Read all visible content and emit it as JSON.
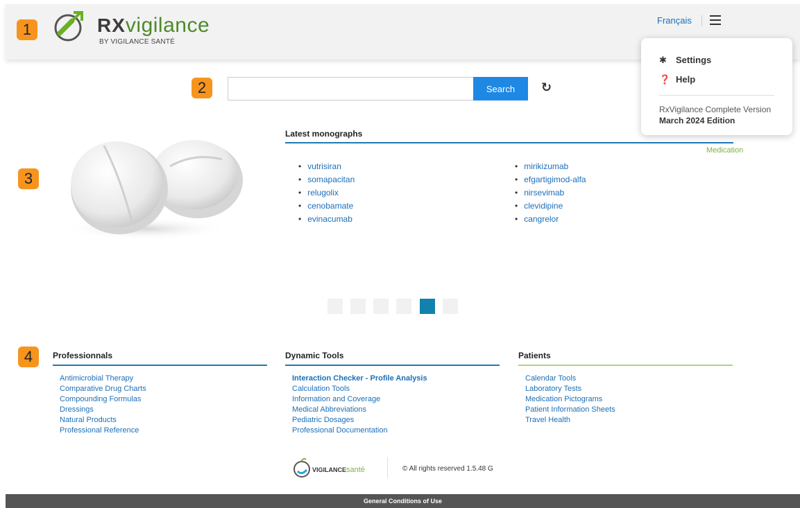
{
  "badges": [
    "1",
    "2",
    "3",
    "4"
  ],
  "header": {
    "logo_rx": "RX",
    "logo_name": "vigilance",
    "logo_sub": "BY VIGILANCE SANTÉ",
    "language_link": "Français"
  },
  "menu": {
    "items": [
      {
        "label": "Settings",
        "icon": "gear-icon"
      },
      {
        "label": "Help",
        "icon": "help-circle-icon"
      }
    ],
    "version": "RxVigilance Complete Version",
    "edition": "March 2024 Edition"
  },
  "search": {
    "value": "",
    "button_label": "Search"
  },
  "monographs": {
    "title": "Latest monographs",
    "tag": "Medication",
    "col1": [
      "vutrisiran",
      "somapacitan",
      "relugolix",
      "cenobamate",
      "evinacumab"
    ],
    "col2": [
      "mirikizumab",
      "efgartigimod-alfa",
      "nirsevimab",
      "clevidipine",
      "cangrelor"
    ],
    "pager_active_index": 4,
    "pager_count": 6
  },
  "footer": {
    "professionals": {
      "title": "Professionnals",
      "items": [
        "Antimicrobial Therapy",
        "Comparative Drug Charts",
        "Compounding Formulas",
        "Dressings",
        "Natural Products",
        "Professional Reference"
      ]
    },
    "tools": {
      "title": "Dynamic Tools",
      "items": [
        "Interaction Checker - Profile Analysis",
        "Calculation Tools",
        "Information and Coverage",
        "Medical Abbreviations",
        "Pediatric Dosages",
        "Professional Documentation"
      ]
    },
    "patients": {
      "title": "Patients",
      "items": [
        "Calendar Tools",
        "Laboratory Tests",
        "Medication Pictograms",
        "Patient Information Sheets",
        "Travel Health"
      ]
    },
    "brand_main": "VIGILANCE",
    "brand_accent": "santé",
    "copyright": "© All rights reserved 1.5.48 G",
    "conditions": "General Conditions of Use"
  },
  "colors": {
    "accent_blue": "#1e88e5",
    "link_blue": "#1b6fb8",
    "brand_green": "#7cb342",
    "badge_orange": "#f7941d"
  }
}
